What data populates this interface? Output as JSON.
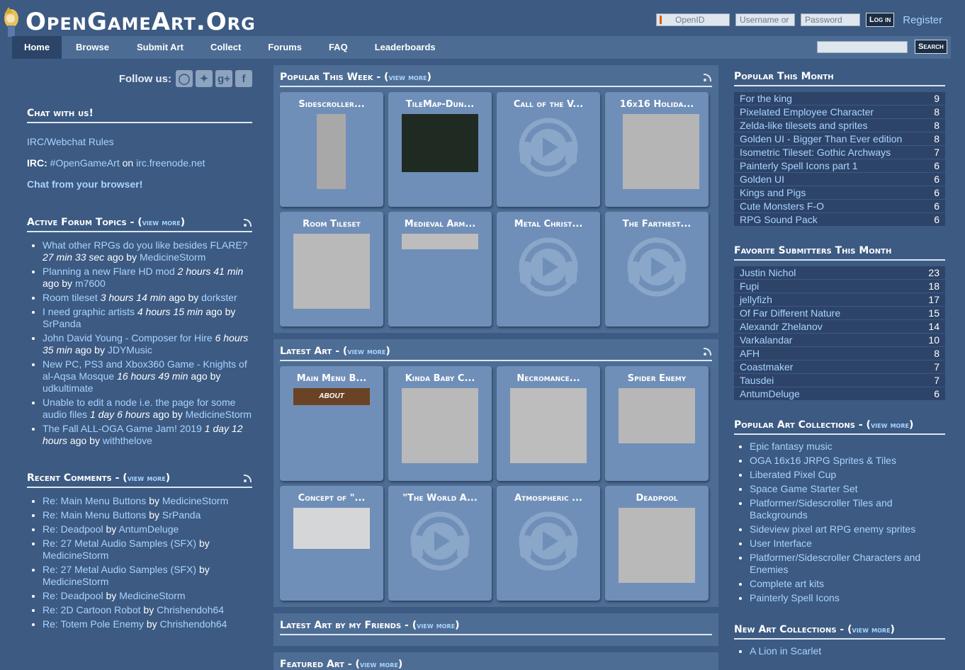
{
  "header": {
    "logo_text": "OpenGameArt.Org",
    "login": {
      "openid_placeholder": "OpenID",
      "username_placeholder": "Username or",
      "password_placeholder": "Password",
      "login_button": "Log in",
      "register_link": "Register"
    },
    "nav": [
      "Home",
      "Browse",
      "Submit Art",
      "Collect",
      "Forums",
      "FAQ",
      "Leaderboards"
    ],
    "search_button": "Search"
  },
  "left": {
    "follow_label": "Follow us:",
    "social_icons": [
      "search-icon",
      "twitter-icon",
      "google-plus-icon",
      "facebook-icon"
    ],
    "chat": {
      "title": "Chat with us!",
      "rules_link": "IRC/Webchat Rules",
      "irc_label": "IRC:",
      "irc_channel": "#OpenGameArt",
      "irc_on": "on",
      "irc_server": "irc.freenode.net",
      "browser_link": "Chat from your browser!"
    },
    "forum": {
      "title": "Active Forum Topics",
      "view_more": "view more",
      "items": [
        {
          "topic": "What other RPGs do you like besides FLARE?",
          "time": "27 min 33 sec",
          "user": "MedicineStorm"
        },
        {
          "topic": "Planning a new Flare HD mod",
          "time": "2 hours 41 min",
          "user": "m7600"
        },
        {
          "topic": "Room tileset",
          "time": "3 hours 14 min",
          "user": "dorkster"
        },
        {
          "topic": "I need graphic artists",
          "time": "4 hours 15 min",
          "user": "SrPanda"
        },
        {
          "topic": "John David Young - Composer for Hire",
          "time": "6 hours 35 min",
          "user": "JDYMusic"
        },
        {
          "topic": "New PC, PS3 and Xbox360 Game - Knights of al-Aqsa Mosque",
          "time": "16 hours 49 min",
          "user": "udkultimate"
        },
        {
          "topic": "Unable to edit a node i.e. the page for some audio files",
          "time": "1 day 6 hours",
          "user": "MedicineStorm"
        },
        {
          "topic": "The Fall ALL-OGA Game Jam! 2019",
          "time": "1 day 12 hours",
          "user": "withthelove"
        }
      ]
    },
    "comments": {
      "title": "Recent Comments",
      "view_more": "view more",
      "items": [
        {
          "topic": "Re: Main Menu Buttons",
          "user": "MedicineStorm"
        },
        {
          "topic": "Re: Main Menu Buttons",
          "user": "SrPanda"
        },
        {
          "topic": "Re: Deadpool",
          "user": "AntumDeluge"
        },
        {
          "topic": "Re: 27 Metal Audio Samples (SFX)",
          "user": "MedicineStorm"
        },
        {
          "topic": "Re: 27 Metal Audio Samples (SFX)",
          "user": "MedicineStorm"
        },
        {
          "topic": "Re: Deadpool",
          "user": "MedicineStorm"
        },
        {
          "topic": "Re: 2D Cartoon Robot",
          "user": "Chrishendoh64"
        },
        {
          "topic": "Re: Totem Pole Enemy",
          "user": "Chrishendoh64"
        }
      ]
    },
    "ago": "ago by",
    "by": "by"
  },
  "middle": {
    "popular_week": {
      "title": "Popular This Week",
      "view_more": "view more",
      "tiles": [
        {
          "title": "Sidescroller...",
          "kind": "image"
        },
        {
          "title": "TileMap-Dun...",
          "kind": "image"
        },
        {
          "title": "Call of the V...",
          "kind": "audio"
        },
        {
          "title": "16x16 Holida...",
          "kind": "image"
        },
        {
          "title": "Room Tileset",
          "kind": "image"
        },
        {
          "title": "Medieval Arm...",
          "kind": "image"
        },
        {
          "title": "Metal Christ...",
          "kind": "audio"
        },
        {
          "title": "The Farthest...",
          "kind": "audio"
        }
      ]
    },
    "latest_art": {
      "title": "Latest Art",
      "view_more": "view more",
      "tiles": [
        {
          "title": "Main Menu B...",
          "kind": "image",
          "thumb_label": "ABOUT"
        },
        {
          "title": "Kinda Baby C...",
          "kind": "image"
        },
        {
          "title": "Necromance...",
          "kind": "image"
        },
        {
          "title": "Spider Enemy",
          "kind": "image"
        },
        {
          "title": "Concept of \"...",
          "kind": "image"
        },
        {
          "title": "\"The World A...",
          "kind": "audio"
        },
        {
          "title": "Atmospheric ...",
          "kind": "audio"
        },
        {
          "title": "Deadpool",
          "kind": "image"
        }
      ]
    },
    "friends": {
      "title": "Latest Art by my Friends",
      "view_more": "view more"
    },
    "featured": {
      "title": "Featured Art",
      "view_more": "view more"
    }
  },
  "right": {
    "popular_month": {
      "title": "Popular This Month",
      "rows": [
        {
          "name": "For the king",
          "count": "9"
        },
        {
          "name": "Pixelated Employee Character",
          "count": "8"
        },
        {
          "name": "Zelda-like tilesets and sprites",
          "count": "8"
        },
        {
          "name": "Golden UI - Bigger Than Ever edition",
          "count": "8"
        },
        {
          "name": "Isometric Tileset: Gothic Archways",
          "count": "7"
        },
        {
          "name": "Painterly Spell Icons part 1",
          "count": "6"
        },
        {
          "name": "Golden UI",
          "count": "6"
        },
        {
          "name": "Kings and Pigs",
          "count": "6"
        },
        {
          "name": "Cute Monsters F-O",
          "count": "6"
        },
        {
          "name": "RPG Sound Pack",
          "count": "6"
        }
      ]
    },
    "submitters": {
      "title": "Favorite Submitters This Month",
      "rows": [
        {
          "name": "Justin Nichol",
          "count": "23"
        },
        {
          "name": "Fupi",
          "count": "18"
        },
        {
          "name": "jellyfizh",
          "count": "17"
        },
        {
          "name": "Of Far Different Nature",
          "count": "15"
        },
        {
          "name": "Alexandr Zhelanov",
          "count": "14"
        },
        {
          "name": "Varkalandar",
          "count": "10"
        },
        {
          "name": "AFH",
          "count": "8"
        },
        {
          "name": "Coastmaker",
          "count": "7"
        },
        {
          "name": "Tausdei",
          "count": "7"
        },
        {
          "name": "AntumDeluge",
          "count": "6"
        }
      ]
    },
    "collections": {
      "title": "Popular Art Collections",
      "view_more": "view more",
      "items": [
        "Epic fantasy music",
        "OGA 16x16 JRPG Sprites & Tiles",
        "Liberated Pixel Cup",
        "Space Game Starter Set",
        "Platformer/Sidescroller Tiles and Backgrounds",
        "Sideview pixel art RPG enemy sprites",
        "User Interface",
        "Platformer/Sidescroller Characters and Enemies",
        "Complete art kits",
        "Painterly Spell Icons"
      ]
    },
    "new_collections": {
      "title": "New Art Collections",
      "view_more": "view more",
      "items": [
        "A Lion in Scarlet"
      ]
    }
  }
}
